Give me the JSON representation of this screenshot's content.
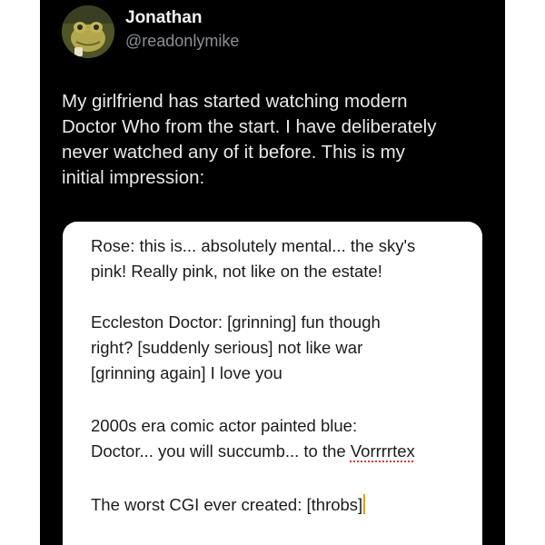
{
  "author": {
    "name": "Jonathan",
    "handle": "@readonlymike"
  },
  "tweet": {
    "lines": [
      "My girlfriend has started watching modern",
      "Doctor Who from the start. I have deliberately",
      "never watched any of it before. This is my",
      "initial impression:"
    ]
  },
  "note": {
    "p1": {
      "line1": "Rose: this is... absolutely mental... the sky's",
      "line2": "pink! Really pink, not like on the estate!"
    },
    "p2": {
      "line1": "Eccleston Doctor: [grinning] fun though",
      "line2": "right? [suddenly serious] not like war",
      "line3": "[grinning again] I love you"
    },
    "p3": {
      "line1": "2000s era comic actor painted blue:",
      "line2_prefix": "Doctor... you will succumb... to the ",
      "line2_misspelled": "Vorrrrtex"
    },
    "p4": {
      "line1": "The worst CGI ever created: [throbs]"
    }
  },
  "colors": {
    "tweet_background": "#000000",
    "page_background": "#ffffff",
    "handle_gray": "#8a8f94",
    "spellcheck_underline": "#d23a3a",
    "caret": "#e0a020"
  },
  "icons": {
    "avatar": "frog-avatar"
  }
}
